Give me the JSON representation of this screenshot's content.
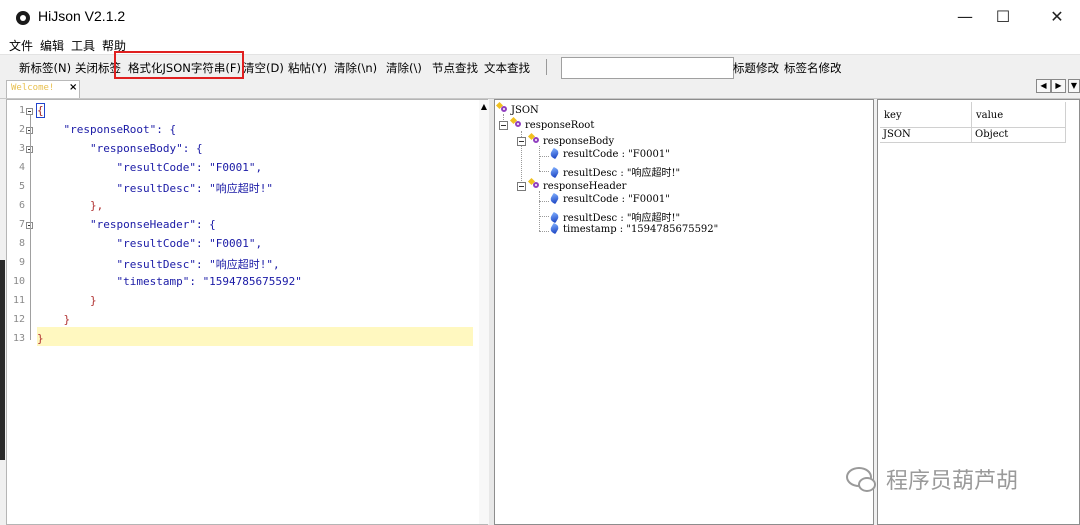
{
  "window": {
    "title": "HiJson V2.1.2",
    "minimize": "—",
    "maximize": "☐",
    "close": "✕"
  },
  "menu": [
    "文件",
    "编辑",
    "工具",
    "帮助"
  ],
  "toolbar": {
    "new_tab": "新标签(N)",
    "close_tab": "关闭标签",
    "format_json": "格式化JSON字符串(F)",
    "clear": "清空(D)",
    "paste": "粘帖(Y)",
    "remove_newline": "清除(\\n)",
    "remove_backslash": "清除(\\)",
    "find_node": "节点查找",
    "find_text": "文本查找",
    "search_value": "",
    "rename_tab": "标题修改",
    "rename_tag": "标签名修改"
  },
  "tab": {
    "label": "Welcome!",
    "close": "×"
  },
  "tab_nav": {
    "prev": "◀",
    "next": "▶",
    "menu": "▼"
  },
  "editor": {
    "line_numbers": [
      "1",
      "2",
      "3",
      "4",
      "5",
      "6",
      "7",
      "8",
      "9",
      "10",
      "11",
      "12",
      "13"
    ],
    "lines": [
      "{",
      "    \"responseRoot\": {",
      "        \"responseBody\": {",
      "            \"resultCode\": \"F0001\",",
      "            \"resultDesc\": \"响应超时!\"",
      "        },",
      "        \"responseHeader\": {",
      "            \"resultCode\": \"F0001\",",
      "            \"resultDesc\": \"响应超时!\",",
      "            \"timestamp\": \"1594785675592\"",
      "        }",
      "    }",
      "}"
    ],
    "scroll_up": "▲"
  },
  "tree": {
    "root": "JSON",
    "responseRoot": "responseRoot",
    "responseBody": "responseBody",
    "body_resultCode": "resultCode : \"F0001\"",
    "body_resultDesc": "resultDesc : \"响应超时!\"",
    "responseHeader": "responseHeader",
    "header_resultCode": "resultCode : \"F0001\"",
    "header_resultDesc": "resultDesc : \"响应超时!\"",
    "header_timestamp": "timestamp : \"1594785675592\""
  },
  "props": {
    "headers": [
      "key",
      "value"
    ],
    "rows": [
      [
        "JSON",
        "Object"
      ]
    ]
  },
  "watermark": "程序员葫芦胡"
}
